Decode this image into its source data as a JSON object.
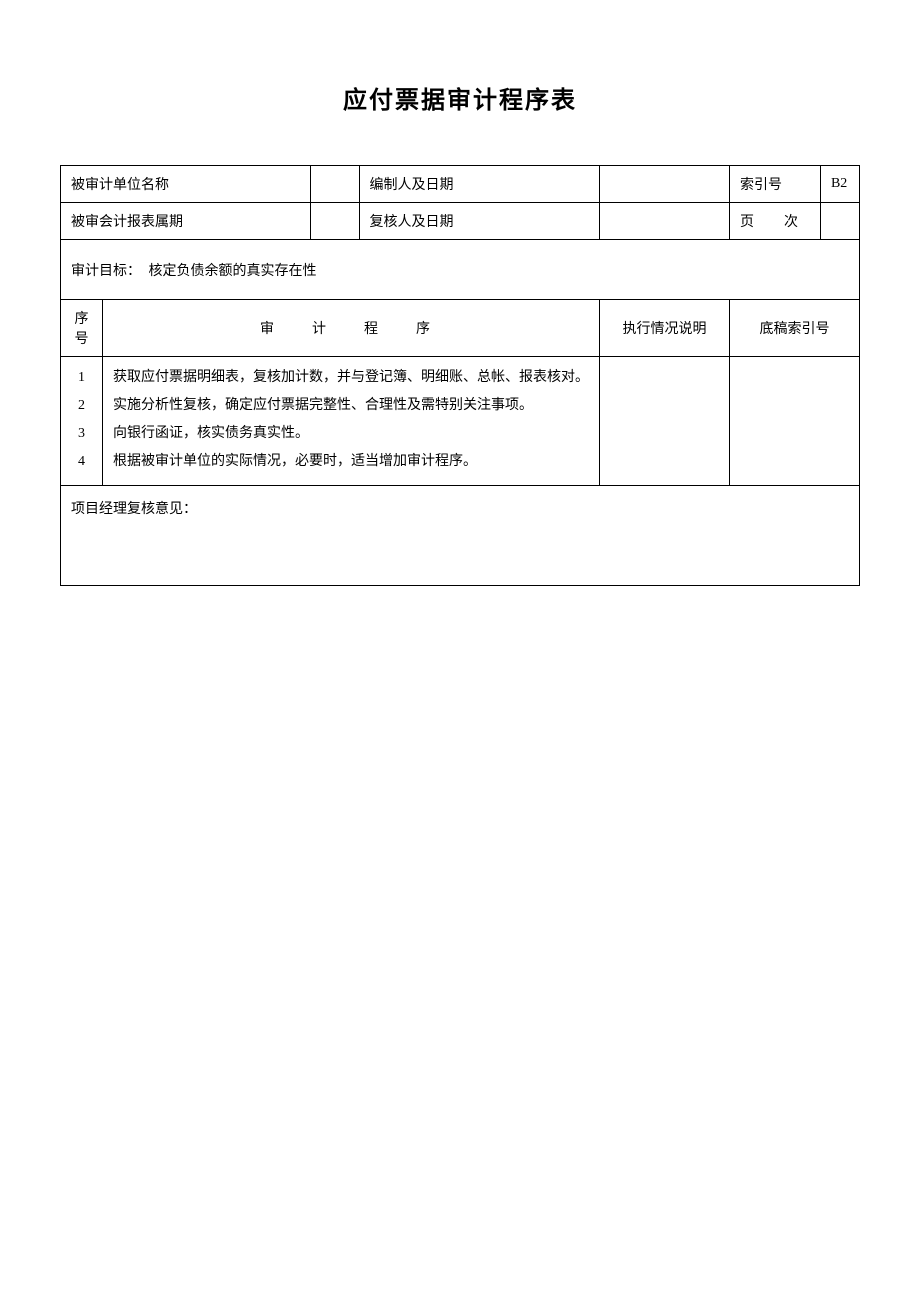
{
  "title": "应付票据审计程序表",
  "meta": {
    "entity_label": "被审计单位名称",
    "entity_value": "",
    "preparer_label": "编制人及日期",
    "preparer_value": "",
    "index_label": "索引号",
    "index_value": "B2",
    "period_label": "被审会计报表属期",
    "period_value": "",
    "reviewer_label": "复核人及日期",
    "reviewer_value": "",
    "page_label": "页　次",
    "page_value": ""
  },
  "objective": {
    "label": "审计目标：",
    "text": "核定负债余额的真实存在性"
  },
  "columns": {
    "seq": "序号",
    "procedure": "审　计　程　序",
    "execution": "执行情况说明",
    "reference": "底稿索引号"
  },
  "procedures": [
    {
      "no": "1",
      "text": "获取应付票据明细表，复核加计数，并与登记簿、明细账、总帐、报表核对。"
    },
    {
      "no": "2",
      "text": "实施分析性复核，确定应付票据完整性、合理性及需特别关注事项。"
    },
    {
      "no": "3",
      "text": "向银行函证，核实债务真实性。"
    },
    {
      "no": "4",
      "text": "根据被审计单位的实际情况，必要时，适当增加审计程序。"
    }
  ],
  "footer": {
    "manager_review": "项目经理复核意见："
  }
}
